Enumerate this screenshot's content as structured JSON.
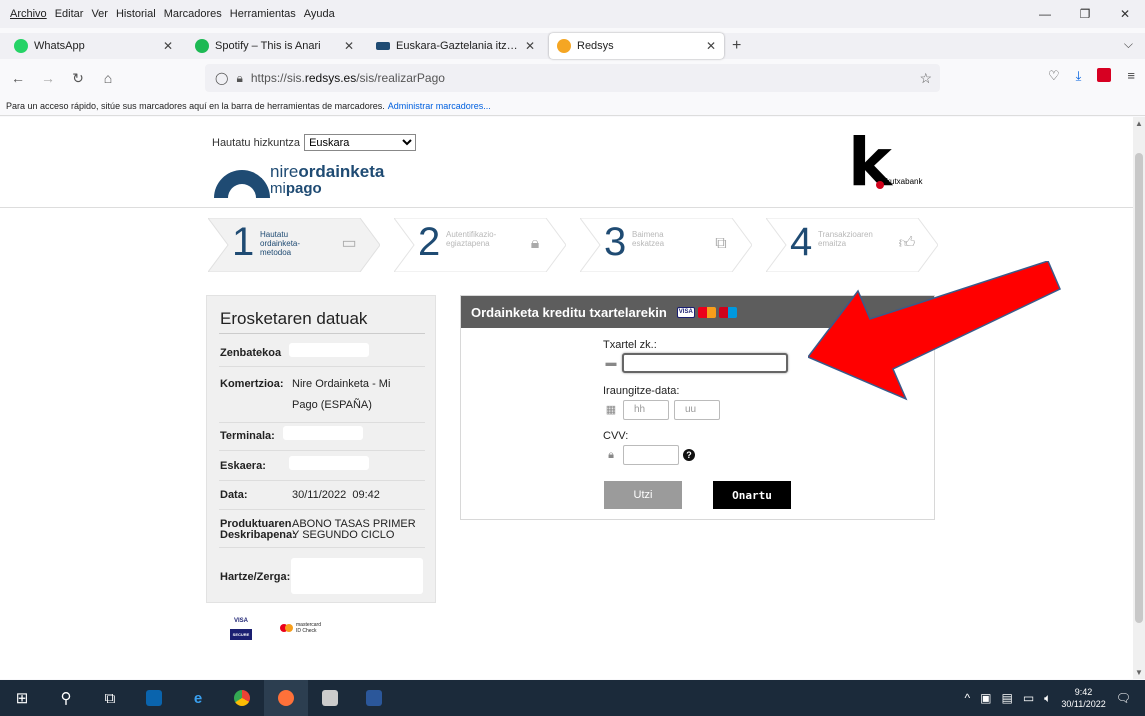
{
  "menu": [
    "Archivo",
    "Editar",
    "Ver",
    "Historial",
    "Marcadores",
    "Herramientas",
    "Ayuda"
  ],
  "window_controls": [
    "—",
    "❐",
    "✕"
  ],
  "tabs": [
    {
      "title": "WhatsApp",
      "color": "#25d366"
    },
    {
      "title": "Spotify – This is Anari",
      "color": "#1db954"
    },
    {
      "title": "Euskara-Gaztelania itzultzaile au",
      "color": "#1f4b73"
    },
    {
      "title": "Redsys",
      "color": "#f5a623"
    }
  ],
  "url": {
    "prefix": "https://sis.",
    "domain": "redsys.es",
    "path": "/sis/realizarPago"
  },
  "bookmarks_bar": {
    "text": "Para un acceso rápido, sitúe sus marcadores aquí en la barra de herramientas de marcadores.",
    "link": "Administrar marcadores..."
  },
  "language": {
    "label": "Hautatu hizkuntza",
    "selected": "Euskara"
  },
  "brand": {
    "line1_light": "nire",
    "line1_bold": "ordainketa",
    "line2_light": "mi",
    "line2_bold": "pago"
  },
  "bank": {
    "letter": "k",
    "name": "kutxabank"
  },
  "steps": [
    {
      "num": "1",
      "label": "Hautatu ordainketa-metodoa",
      "icon": "credit-card-icon",
      "active": true
    },
    {
      "num": "2",
      "label": "Autentifikazio-egiaztapena",
      "icon": "lock-icon",
      "active": false
    },
    {
      "num": "3",
      "label": "Baimena eskatzea",
      "icon": "network-icon",
      "active": false
    },
    {
      "num": "4",
      "label": "Transakzioaren emaitza",
      "icon": "thumbs-up-icon",
      "active": false
    }
  ],
  "purchase": {
    "title": "Erosketaren datuak",
    "amount_label": "Zenbatekoa",
    "merchant_label": "Komertzioa:",
    "merchant_value": "Nire Ordainketa - Mi Pago (ESPAÑA)",
    "terminal_label": "Terminala:",
    "order_label": "Eskaera:",
    "date_label": "Data:",
    "date_value": "30/11/2022  09:42",
    "product_label": "Produktuaren Deskribapena:",
    "product_value": "ABONO TASAS PRIMER Y SEGUNDO CICLO",
    "payee_label": "Hartze/Zerga:"
  },
  "payment": {
    "title": "Ordainketa kreditu txartelarekin",
    "card_label": "Txartel zk.:",
    "expiry_label": "Iraungitze-data:",
    "month_placeholder": "hh",
    "year_placeholder": "uu",
    "cvv_label": "CVV:",
    "cancel": "Utzi",
    "accept": "Onartu"
  },
  "footer_logos": {
    "visa": "VISA",
    "visa_sub": "SECURE",
    "mastercard": "mastercard",
    "mastercard_sub": "ID Check"
  },
  "taskbar": {
    "time": "9:42",
    "date": "30/11/2022"
  },
  "colors": {
    "brand_blue": "#1f4b73",
    "arrow_red": "#ff0000",
    "cancel_grey": "#9b9b9b"
  }
}
